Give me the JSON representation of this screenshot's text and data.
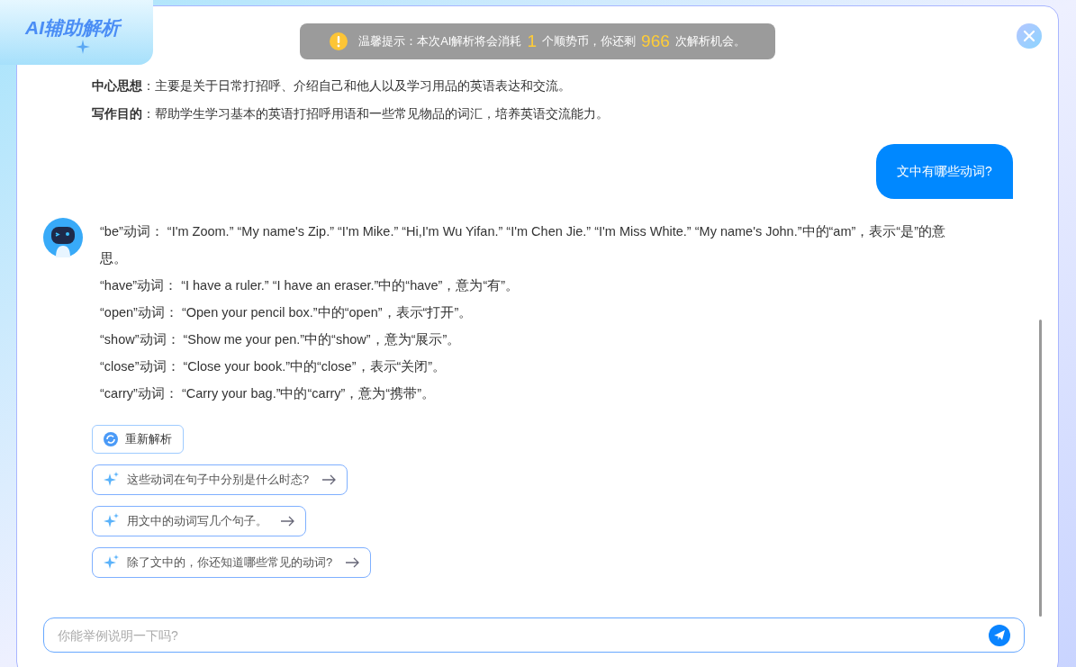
{
  "header": {
    "logo": "AI辅助解析"
  },
  "notice": {
    "label": "温馨提示：本次AI解析将会消耗",
    "cost": "1",
    "middle": "个顺势币，你还剩",
    "remaining": "966",
    "tail": "次解析机会。"
  },
  "summary": [
    "**中心思想**：主要是关于日常打招呼、介绍自己和他人以及学习用品的英语表达和交流。",
    "**写作目的**：帮助学生学习基本的英语打招呼用语和一些常见物品的词汇，培养英语交流能力。"
  ],
  "user_message": "文中有哪些动词?",
  "answer_lines": [
    "“be”动词： “I'm Zoom.” “My name's Zip.” “I'm Mike.” “Hi,I'm Wu Yifan.” “I'm Chen Jie.” “I'm Miss White.” “My name's John.”中的“am”，表示“是”的意思。",
    "“have”动词： “I have a ruler.” “I have an eraser.”中的“have”，意为“有”。",
    "“open”动词： “Open your pencil box.”中的“open”，表示“打开”。",
    "“show”动词： “Show me your pen.”中的“show”，意为“展示”。",
    "“close”动词： “Close your book.”中的“close”，表示“关闭”。",
    "“carry”动词： “Carry your bag.”中的“carry”，意为“携带”。"
  ],
  "regenerate_button": "重新解析",
  "suggestions": [
    "这些动词在句子中分别是什么时态?",
    "用文中的动词写几个句子。",
    "除了文中的，你还知道哪些常见的动词?"
  ],
  "input": {
    "placeholder": "你能举例说明一下吗?"
  }
}
